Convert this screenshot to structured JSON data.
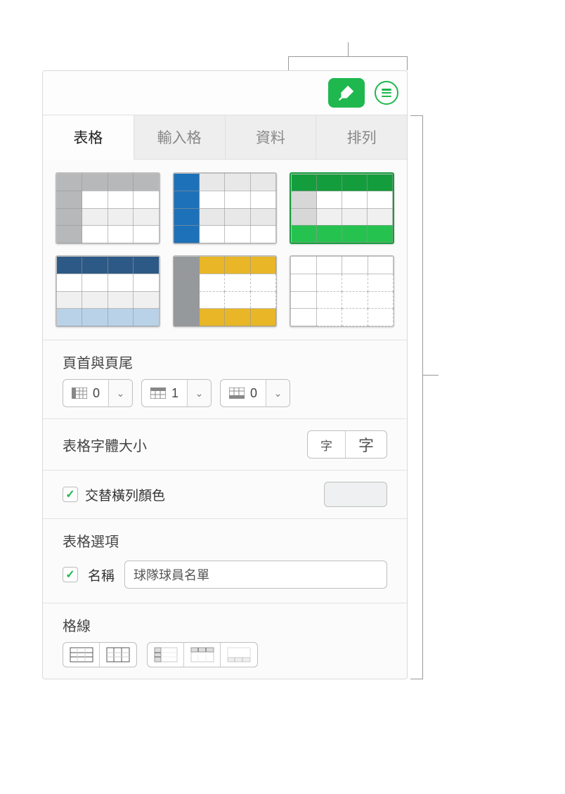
{
  "tabs": {
    "table": "表格",
    "cell": "輸入格",
    "data": "資料",
    "arrange": "排列"
  },
  "sections": {
    "headers_footers": {
      "title": "頁首與頁尾",
      "col_value": "0",
      "row_value": "1",
      "footer_value": "0"
    },
    "font_size": {
      "title": "表格字體大小",
      "small": "字",
      "large": "字"
    },
    "alternating": {
      "label": "交替橫列顏色"
    },
    "options": {
      "title": "表格選項",
      "name_label": "名稱",
      "name_value": "球隊球員名單"
    },
    "gridlines": {
      "title": "格線"
    }
  }
}
